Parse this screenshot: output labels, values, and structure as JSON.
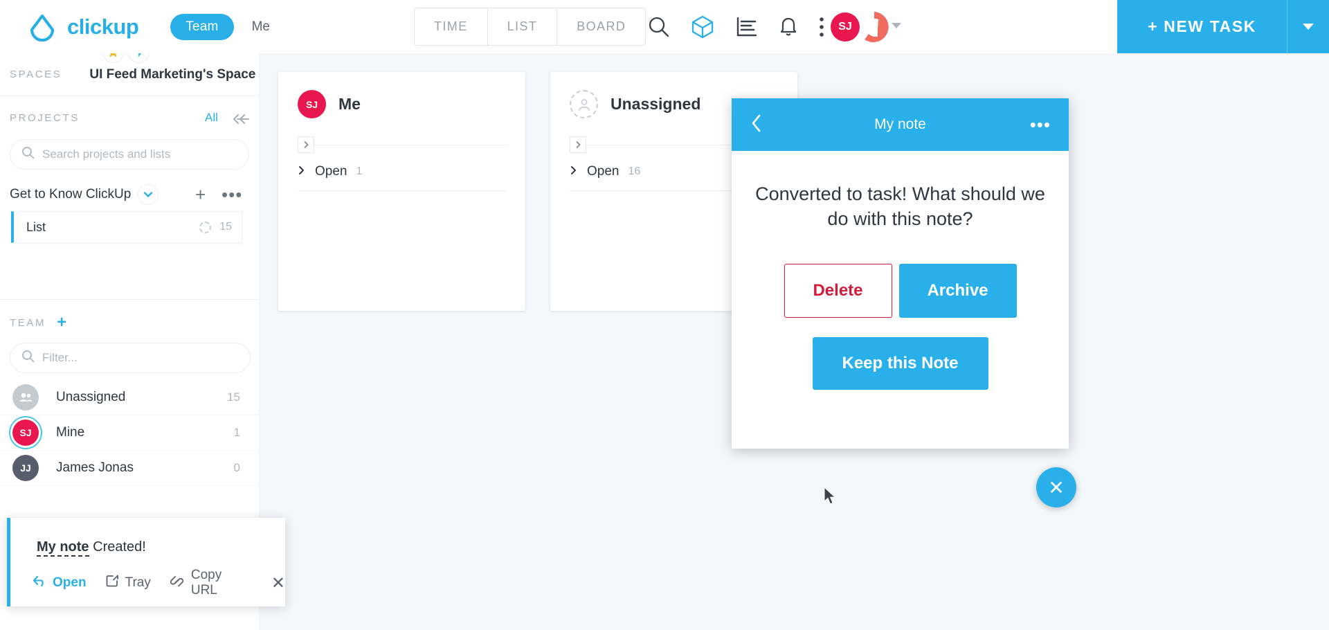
{
  "header": {
    "brand": "clickup",
    "logo_icon": "clickup-teardrop-logo",
    "team_tab": "Team",
    "me_tab": "Me",
    "view_tabs": [
      "TIME",
      "LIST",
      "BOARD"
    ],
    "icons": [
      "search-icon",
      "cube-icon",
      "chart-icon",
      "bell-icon",
      "more-vertical-icon"
    ],
    "avatar_initials": "SJ",
    "new_task_label": "+ NEW TASK",
    "accent_color": "#29b0ea",
    "avatar_color": "#e8174f"
  },
  "sidebar": {
    "pills": [
      "star-icon",
      "lightning-icon"
    ],
    "spaces_label": "SPACES",
    "space_name": "UI Feed Marketing's Space",
    "projects_label": "PROJECTS",
    "all_link": "All",
    "search_placeholder": "Search projects and lists",
    "search_value": "",
    "project_group": "Get to Know ClickUp",
    "lists": [
      {
        "name": "List",
        "count": "15"
      }
    ],
    "team_label": "TEAM",
    "filter_placeholder": "Filter...",
    "filter_value": "",
    "members": [
      {
        "name": "Unassigned",
        "initials": "",
        "count": "15",
        "color": "#c5cad1",
        "selected": false
      },
      {
        "name": "Mine",
        "initials": "SJ",
        "count": "1",
        "color": "#e8174f",
        "selected": true
      },
      {
        "name": "James Jonas",
        "initials": "JJ",
        "count": "0",
        "color": "#565d6b",
        "selected": false
      }
    ]
  },
  "board": {
    "columns": [
      {
        "title": "Me",
        "avatar_initials": "SJ",
        "avatar_color": "#e8174f",
        "avatar_type": "initials",
        "group_name": "Open",
        "group_count": "1"
      },
      {
        "title": "Unassigned",
        "avatar_initials": "",
        "avatar_color": "#c9ced5",
        "avatar_type": "dashed-person",
        "group_name": "Open",
        "group_count": "16"
      }
    ]
  },
  "modal": {
    "title": "My note",
    "back_icon": "chevron-left-icon",
    "menu_icon": "more-horizontal-icon",
    "message": "Converted to task! What should we do with this note?",
    "delete_label": "Delete",
    "archive_label": "Archive",
    "keep_label": "Keep this Note",
    "delete_color": "#d21c3c"
  },
  "toast": {
    "note_name": "My note",
    "message_suffix": " Created!",
    "actions": [
      {
        "label": "Open",
        "icon": "reply-arrow-icon",
        "primary": true
      },
      {
        "label": "Tray",
        "icon": "tray-icon",
        "primary": false
      },
      {
        "label": "Copy URL",
        "icon": "link-icon",
        "primary": false
      }
    ],
    "close_label": "✕"
  },
  "fab": {
    "label": "✕",
    "icon": "close-icon"
  }
}
